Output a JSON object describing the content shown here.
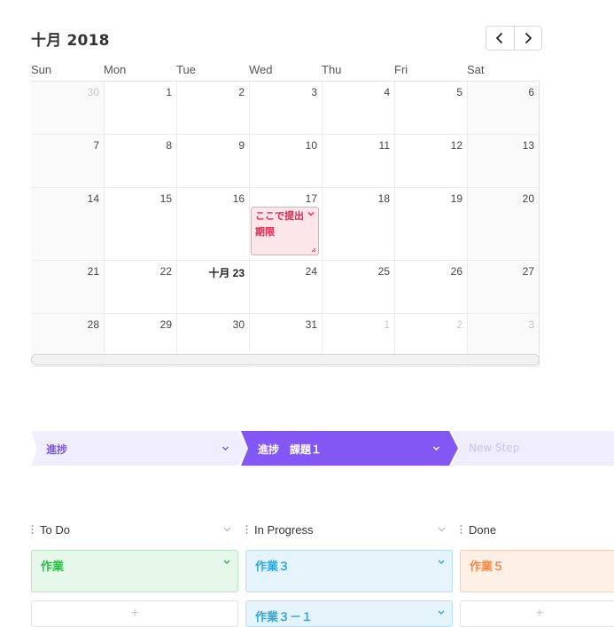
{
  "calendar": {
    "title": "十月 2018",
    "weekdays": [
      "Sun",
      "Mon",
      "Tue",
      "Wed",
      "Thu",
      "Fri",
      "Sat"
    ],
    "weeks": [
      [
        "30",
        "1",
        "2",
        "3",
        "4",
        "5",
        "6"
      ],
      [
        "7",
        "8",
        "9",
        "10",
        "11",
        "12",
        "13"
      ],
      [
        "14",
        "15",
        "16",
        "17",
        "18",
        "19",
        "20"
      ],
      [
        "21",
        "22",
        "十月 23",
        "24",
        "25",
        "26",
        "27"
      ],
      [
        "28",
        "29",
        "30",
        "31",
        "1",
        "2",
        "3"
      ]
    ],
    "event": {
      "line1": "ここで提出",
      "line2": "期限"
    }
  },
  "path": {
    "steps": [
      {
        "label": "進捗",
        "state": "complete"
      },
      {
        "label": "進捗　課題１",
        "state": "current"
      },
      {
        "label": "New Step",
        "state": "upcoming"
      }
    ]
  },
  "board": {
    "columns": [
      {
        "title": "To Do",
        "cards": [
          "作業"
        ],
        "add_label": "+"
      },
      {
        "title": "In Progress",
        "cards": [
          "作業３",
          "作業３－１"
        ],
        "add_label": ""
      },
      {
        "title": "Done",
        "cards": [
          "作業５"
        ],
        "add_label": "+"
      }
    ]
  },
  "colors": {
    "accent_purple": "#8257f3",
    "event_red": "#e0294c",
    "todo_green": "#2fb84a",
    "progress_blue": "#30a8dd",
    "done_orange": "#f5874a"
  },
  "icons": [
    "chevron-left-icon",
    "chevron-right-icon",
    "chevron-down-icon",
    "drag-handle-icon",
    "resize-grip-icon",
    "plus-icon"
  ]
}
